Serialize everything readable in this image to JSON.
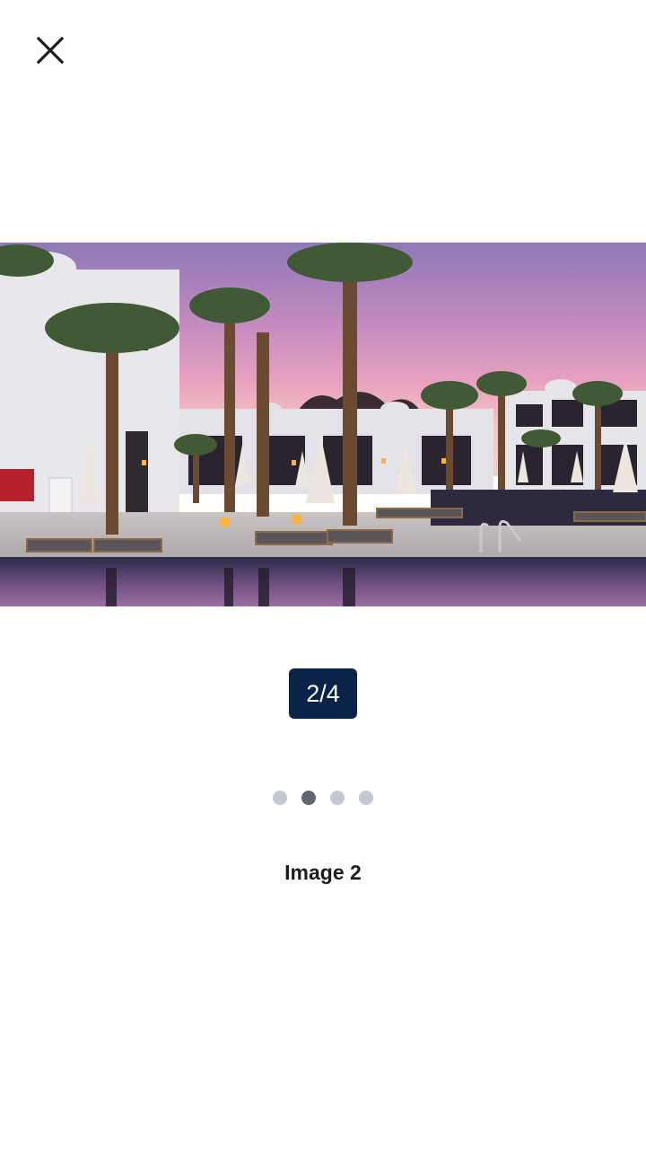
{
  "viewer": {
    "close_icon": "close-icon",
    "counter": "2/4",
    "caption": "Image 2",
    "current_index": 2,
    "total": 4,
    "dots": [
      {
        "active": false
      },
      {
        "active": true
      },
      {
        "active": false
      },
      {
        "active": false
      }
    ]
  },
  "colors": {
    "counter_bg": "#0b2347",
    "dot_inactive": "#c2c8d0",
    "dot_active": "#5e6670",
    "caption_text": "#1d1d1f"
  }
}
